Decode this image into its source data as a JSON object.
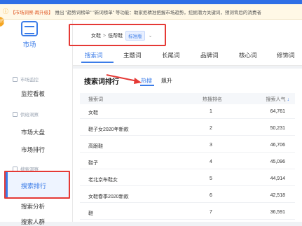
{
  "notice": {
    "prefix": "【市场洞察-再升级】",
    "text": "推出 \"趋势词榜单\" \"新词榜单\" 等功能：助家拒精准把握市场趋势，挖掘潜力关键词，预测背后的消费者"
  },
  "sidebar": {
    "badge": "的",
    "logo_label": "市场",
    "sections": [
      {
        "label": "市场监控",
        "items": [
          "监控看板"
        ]
      },
      {
        "label": "供给洞察",
        "items": [
          "市场大盘",
          "市场排行"
        ]
      },
      {
        "label": "搜索洞察",
        "items": [
          "搜索排行",
          "搜索分析",
          "搜索人群"
        ]
      }
    ],
    "active_item": "搜索排行"
  },
  "breadcrumb": {
    "category": "女鞋",
    "separator": ">",
    "subcategory": "低帮鞋",
    "edition": "标准版"
  },
  "tabs": [
    "搜索词",
    "长尾词",
    "品牌词",
    "核心词",
    "修饰词"
  ],
  "tabs_all": [
    "搜索词",
    "主题词",
    "长尾词",
    "品牌词",
    "核心词",
    "修饰词"
  ],
  "active_tab": "搜索词",
  "ranking": {
    "title": "搜索词排行",
    "subtabs": [
      "热搜",
      "飙升"
    ],
    "active_subtab": "热搜",
    "columns": {
      "keyword": "搜索词",
      "rank": "热搜排名",
      "popularity": "搜索人气"
    },
    "rows": [
      {
        "keyword": "女鞋",
        "rank": "1",
        "popularity": "64,761"
      },
      {
        "keyword": "鞋子女2020年新款",
        "rank": "2",
        "popularity": "50,231"
      },
      {
        "keyword": "高跟鞋",
        "rank": "3",
        "popularity": "46,706"
      },
      {
        "keyword": "鞋子",
        "rank": "4",
        "popularity": "45,096"
      },
      {
        "keyword": "老北京布鞋女",
        "rank": "5",
        "popularity": "44,914"
      },
      {
        "keyword": "女鞋春季2020新款",
        "rank": "6",
        "popularity": "42,518"
      },
      {
        "keyword": "鞋",
        "rank": "7",
        "popularity": "36,591"
      }
    ]
  },
  "colors": {
    "accent": "#3b7ce8",
    "highlight_box": "#e53935",
    "arrow": "#e53935"
  }
}
